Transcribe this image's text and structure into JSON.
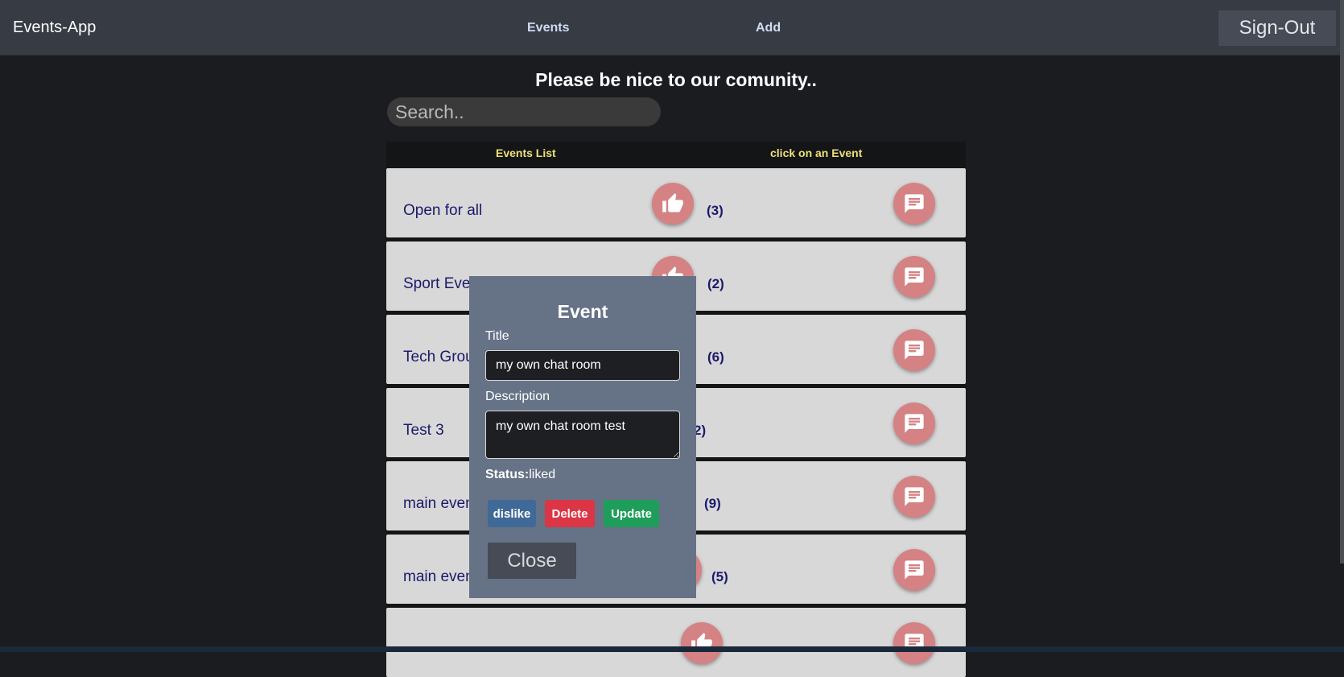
{
  "navbar": {
    "brand": "Events-App",
    "events_link": "Events",
    "add_link": "Add",
    "signout_label": "Sign-Out"
  },
  "heading": "Please be nice to our comunity..",
  "search": {
    "placeholder": "Search..",
    "value": ""
  },
  "columns": {
    "left": "Events List",
    "right": "click on an Event"
  },
  "events": [
    {
      "title": "Open for all",
      "likes": "(3)"
    },
    {
      "title": "Sport Eve",
      "likes": "(2)"
    },
    {
      "title": "Tech Grou",
      "likes": "(6)"
    },
    {
      "title": "Test 3",
      "likes": "2)"
    },
    {
      "title": "main even",
      "likes": "(9)"
    },
    {
      "title": "main even",
      "likes": "(5)"
    },
    {
      "title": "",
      "likes": ""
    }
  ],
  "modal": {
    "title": "Event",
    "title_label": "Title",
    "title_value": "my own chat room",
    "description_label": "Description",
    "description_value": "my own chat room test",
    "status_label": "Status:",
    "status_value": "liked",
    "dislike_label": "dislike",
    "delete_label": "Delete",
    "update_label": "Update",
    "close_label": "Close"
  },
  "colors": {
    "navbar": "#363b44",
    "background": "#1b1c1f",
    "row": "#d8d8d8",
    "accent_button": "#d58284",
    "modal": "#667286",
    "dislike": "#3f6a97",
    "delete": "#dc3545",
    "update": "#1e9e5a",
    "column_header": "#ede07a"
  },
  "icons": {
    "like": "thumb-up-icon",
    "chat": "chat-bubble-icon"
  }
}
